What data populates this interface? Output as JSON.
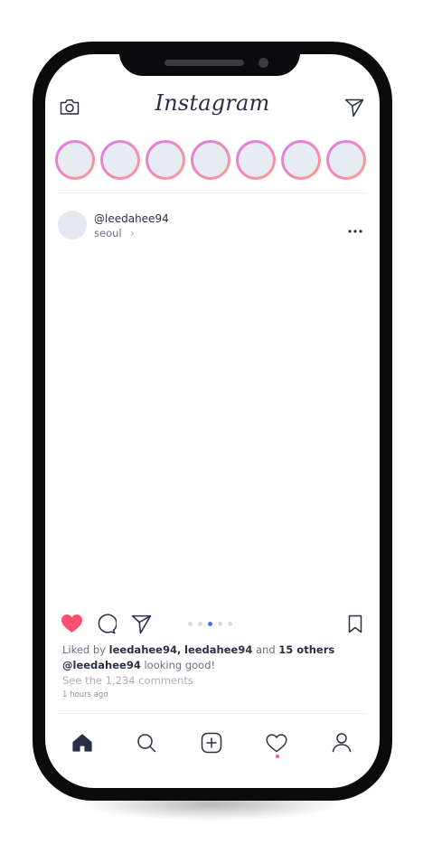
{
  "header": {
    "logo_text": "Instagram",
    "camera_icon": "camera-icon",
    "direct_icon": "paper-plane-icon"
  },
  "stories": {
    "count": 7,
    "ring_colors": [
      "#d97cf0",
      "#f08ab8",
      "#f7a28a"
    ]
  },
  "post": {
    "username": "@leedahee94",
    "location": "seoul",
    "location_chevron": "›",
    "more_icon": "more-dots-icon",
    "carousel": {
      "total": 5,
      "active_index": 2
    },
    "liked": true,
    "likes": {
      "prefix": "Liked by ",
      "user1": "leedahee94,",
      "user2": "leedahee94",
      "middle": " and ",
      "others": "15 others"
    },
    "caption": {
      "user": "@leedahee94",
      "text": " looking good!"
    },
    "comments_link": "See the 1,234 comments",
    "time_ago": "1 hours ago"
  },
  "nav": {
    "items": [
      "home-icon",
      "search-icon",
      "add-post-icon",
      "activity-heart-icon",
      "profile-icon"
    ],
    "activity_badge": true
  },
  "colors": {
    "like_red": "#ff4f6e",
    "ink": "#2b2f45",
    "accent_blue": "#4c6fff"
  }
}
